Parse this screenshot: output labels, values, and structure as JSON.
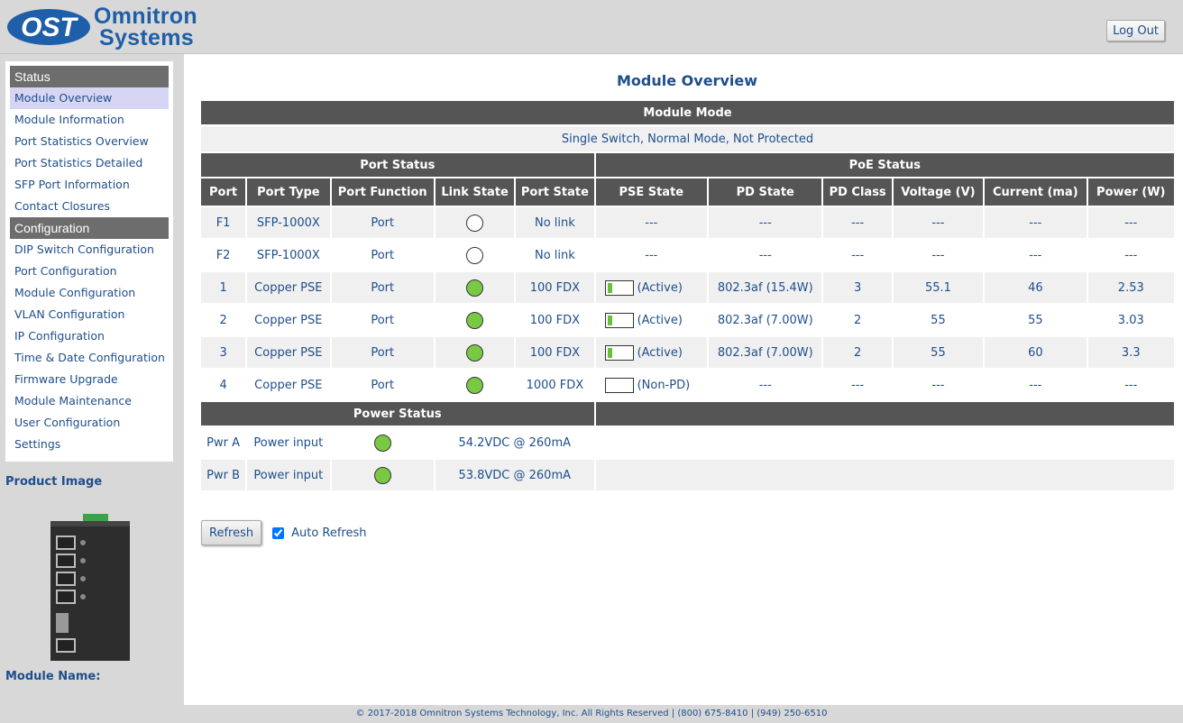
{
  "header": {
    "logo_mark": "OST",
    "logo_line1": "Omnitron",
    "logo_line2": "Systems",
    "logout_label": "Log Out"
  },
  "sidebar": {
    "status_section": "Status",
    "status_items": [
      "Module Overview",
      "Module Information",
      "Port Statistics Overview",
      "Port Statistics Detailed",
      "SFP Port Information",
      "Contact Closures"
    ],
    "config_section": "Configuration",
    "config_items": [
      "DIP Switch Configuration",
      "Port Configuration",
      "Module Configuration",
      "VLAN Configuration",
      "IP Configuration",
      "Time & Date Configuration",
      "Firmware Upgrade",
      "Module Maintenance",
      "User Configuration",
      "Settings"
    ],
    "product_image_label": "Product Image",
    "module_name_label": "Module Name:",
    "module_name_value": ""
  },
  "main": {
    "title": "Module Overview",
    "module_mode_header": "Module Mode",
    "module_mode_value": "Single Switch, Normal Mode, Not Protected",
    "port_status_header": "Port Status",
    "poe_status_header": "PoE Status",
    "columns": [
      "Port",
      "Port Type",
      "Port Function",
      "Link State",
      "Port State",
      "PSE State",
      "PD State",
      "PD Class",
      "Voltage (V)",
      "Current (ma)",
      "Power (W)"
    ],
    "ports": [
      {
        "port": "F1",
        "type": "SFP-1000X",
        "function": "Port",
        "link": "off",
        "state": "No link",
        "pse_bar": null,
        "pse": "---",
        "pd_state": "---",
        "pd_class": "---",
        "voltage": "---",
        "current": "---",
        "power": "---"
      },
      {
        "port": "F2",
        "type": "SFP-1000X",
        "function": "Port",
        "link": "off",
        "state": "No link",
        "pse_bar": null,
        "pse": "---",
        "pd_state": "---",
        "pd_class": "---",
        "voltage": "---",
        "current": "---",
        "power": "---"
      },
      {
        "port": "1",
        "type": "Copper PSE",
        "function": "Port",
        "link": "on",
        "state": "100 FDX",
        "pse_bar": 0.2,
        "pse": "(Active)",
        "pd_state": "802.3af (15.4W)",
        "pd_class": "3",
        "voltage": "55.1",
        "current": "46",
        "power": "2.53"
      },
      {
        "port": "2",
        "type": "Copper PSE",
        "function": "Port",
        "link": "on",
        "state": "100 FDX",
        "pse_bar": 0.2,
        "pse": "(Active)",
        "pd_state": "802.3af (7.00W)",
        "pd_class": "2",
        "voltage": "55",
        "current": "55",
        "power": "3.03"
      },
      {
        "port": "3",
        "type": "Copper PSE",
        "function": "Port",
        "link": "on",
        "state": "100 FDX",
        "pse_bar": 0.2,
        "pse": "(Active)",
        "pd_state": "802.3af (7.00W)",
        "pd_class": "2",
        "voltage": "55",
        "current": "60",
        "power": "3.3"
      },
      {
        "port": "4",
        "type": "Copper PSE",
        "function": "Port",
        "link": "on",
        "state": "1000 FDX",
        "pse_bar": 0,
        "pse": "(Non-PD)",
        "pd_state": "---",
        "pd_class": "---",
        "voltage": "---",
        "current": "---",
        "power": "---"
      }
    ],
    "power_status_header": "Power Status",
    "power": [
      {
        "name": "Pwr A",
        "desc": "Power input",
        "state": "on",
        "value": "54.2VDC @ 260mA"
      },
      {
        "name": "Pwr B",
        "desc": "Power input",
        "state": "on",
        "value": "53.8VDC @ 260mA"
      }
    ],
    "refresh_label": "Refresh",
    "auto_refresh_label": "Auto Refresh",
    "auto_refresh_checked": true
  },
  "footer": {
    "text": "© 2017-2018 Omnitron Systems Technology, Inc. All Rights Reserved | (800) 675-8410 | (949) 250-6510"
  },
  "colors": {
    "accent": "#1e4e8c",
    "header_bg": "#555555",
    "link_on": "#7ac943",
    "sidebar_active": "#d6d6f4"
  }
}
